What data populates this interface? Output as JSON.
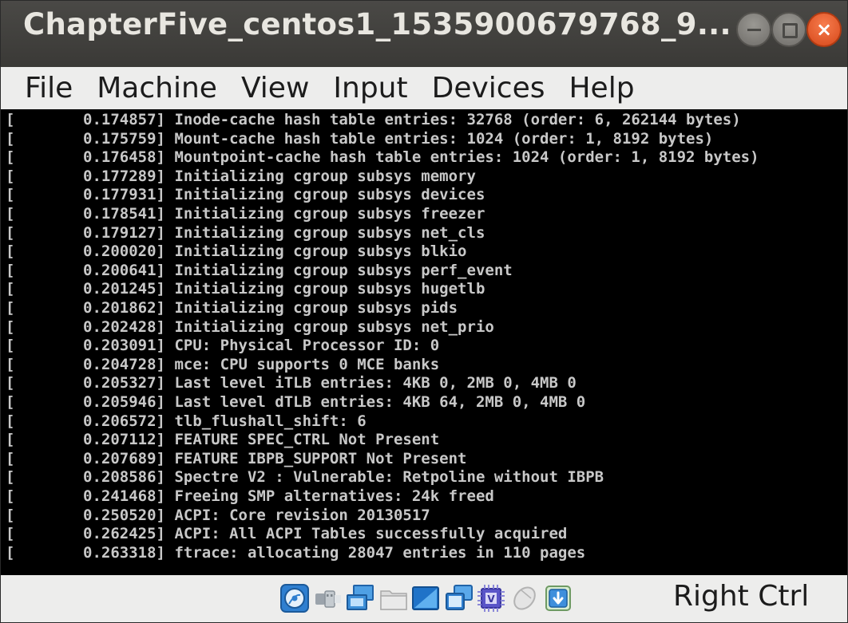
{
  "window": {
    "title": "ChapterFive_centos1_1535900679768_9...",
    "buttons": {
      "minimize": "minimize",
      "maximize": "maximize",
      "close": "×"
    }
  },
  "menubar": {
    "items": [
      {
        "label": "File"
      },
      {
        "label": "Machine"
      },
      {
        "label": "View"
      },
      {
        "label": "Input"
      },
      {
        "label": "Devices"
      },
      {
        "label": "Help"
      }
    ]
  },
  "console": {
    "lines": [
      {
        "bracket": "[",
        "ts": "0.174857]",
        "msg": "Inode-cache hash table entries: 32768 (order: 6, 262144 bytes)"
      },
      {
        "bracket": "[",
        "ts": "0.175759]",
        "msg": "Mount-cache hash table entries: 1024 (order: 1, 8192 bytes)"
      },
      {
        "bracket": "[",
        "ts": "0.176458]",
        "msg": "Mountpoint-cache hash table entries: 1024 (order: 1, 8192 bytes)"
      },
      {
        "bracket": "[",
        "ts": "0.177289]",
        "msg": "Initializing cgroup subsys memory"
      },
      {
        "bracket": "[",
        "ts": "0.177931]",
        "msg": "Initializing cgroup subsys devices"
      },
      {
        "bracket": "[",
        "ts": "0.178541]",
        "msg": "Initializing cgroup subsys freezer"
      },
      {
        "bracket": "[",
        "ts": "0.179127]",
        "msg": "Initializing cgroup subsys net_cls"
      },
      {
        "bracket": "[",
        "ts": "0.200020]",
        "msg": "Initializing cgroup subsys blkio"
      },
      {
        "bracket": "[",
        "ts": "0.200641]",
        "msg": "Initializing cgroup subsys perf_event"
      },
      {
        "bracket": "[",
        "ts": "0.201245]",
        "msg": "Initializing cgroup subsys hugetlb"
      },
      {
        "bracket": "[",
        "ts": "0.201862]",
        "msg": "Initializing cgroup subsys pids"
      },
      {
        "bracket": "[",
        "ts": "0.202428]",
        "msg": "Initializing cgroup subsys net_prio"
      },
      {
        "bracket": "[",
        "ts": "0.203091]",
        "msg": "CPU: Physical Processor ID: 0"
      },
      {
        "bracket": "[",
        "ts": "0.204728]",
        "msg": "mce: CPU supports 0 MCE banks"
      },
      {
        "bracket": "[",
        "ts": "0.205327]",
        "msg": "Last level iTLB entries: 4KB 0, 2MB 0, 4MB 0"
      },
      {
        "bracket": "[",
        "ts": "0.205946]",
        "msg": "Last level dTLB entries: 4KB 64, 2MB 0, 4MB 0"
      },
      {
        "bracket": "[",
        "ts": "0.206572]",
        "msg": "tlb_flushall_shift: 6"
      },
      {
        "bracket": "[",
        "ts": "0.207112]",
        "msg": "FEATURE SPEC_CTRL Not Present"
      },
      {
        "bracket": "[",
        "ts": "0.207689]",
        "msg": "FEATURE IBPB_SUPPORT Not Present"
      },
      {
        "bracket": "[",
        "ts": "0.208586]",
        "msg": "Spectre V2 : Vulnerable: Retpoline without IBPB"
      },
      {
        "bracket": "[",
        "ts": "0.241468]",
        "msg": "Freeing SMP alternatives: 24k freed"
      },
      {
        "bracket": "[",
        "ts": "0.250520]",
        "msg": "ACPI: Core revision 20130517"
      },
      {
        "bracket": "[",
        "ts": "0.262425]",
        "msg": "ACPI: All ACPI Tables successfully acquired"
      },
      {
        "bracket": "[",
        "ts": "0.263318]",
        "msg": "ftrace: allocating 28047 entries in 110 pages"
      }
    ]
  },
  "statusbar": {
    "icons": [
      {
        "name": "optical-drive-icon"
      },
      {
        "name": "usb-icon"
      },
      {
        "name": "network-icon"
      },
      {
        "name": "shared-folders-icon"
      },
      {
        "name": "display-icon"
      },
      {
        "name": "video-capture-icon"
      },
      {
        "name": "cpu-icon"
      },
      {
        "name": "mouse-integration-icon"
      },
      {
        "name": "keyboard-capture-icon"
      }
    ],
    "host_key": "Right Ctrl"
  }
}
